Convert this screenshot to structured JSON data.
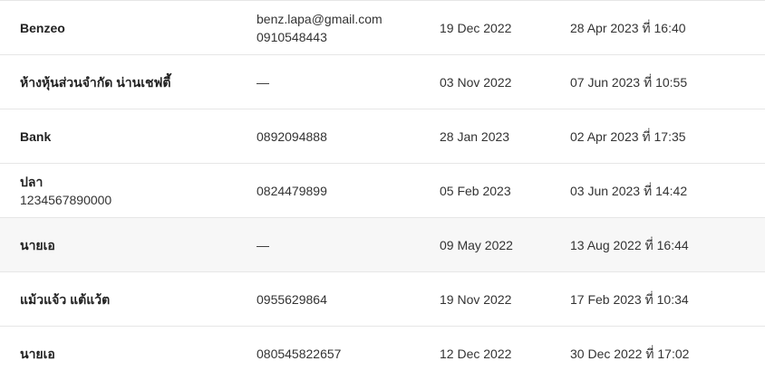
{
  "rows": [
    {
      "name": "Benzeo",
      "name_sub": "",
      "contact_1": "benz.lapa@gmail.com",
      "contact_2": "0910548443",
      "created": "19 Dec 2022",
      "last": "28 Apr 2023 ที่ 16:40",
      "highlight": false
    },
    {
      "name": "ห้างหุ้นส่วนจำกัด น่านเชฟตี้",
      "name_sub": "",
      "contact_1": "—",
      "contact_2": "",
      "created": "03 Nov 2022",
      "last": "07 Jun 2023 ที่ 10:55",
      "highlight": false
    },
    {
      "name": "Bank",
      "name_sub": "",
      "contact_1": "0892094888",
      "contact_2": "",
      "created": "28 Jan 2023",
      "last": "02 Apr 2023 ที่ 17:35",
      "highlight": false
    },
    {
      "name": "ปลา",
      "name_sub": "1234567890000",
      "contact_1": "0824479899",
      "contact_2": "",
      "created": "05 Feb 2023",
      "last": "03 Jun 2023 ที่ 14:42",
      "highlight": false
    },
    {
      "name": "นายเอ",
      "name_sub": "",
      "contact_1": "—",
      "contact_2": "",
      "created": "09 May 2022",
      "last": "13 Aug 2022 ที่ 16:44",
      "highlight": true
    },
    {
      "name": "แม้วแจ้ว แต้แว้ต",
      "name_sub": "",
      "contact_1": "0955629864",
      "contact_2": "",
      "created": "19 Nov 2022",
      "last": "17 Feb 2023 ที่ 10:34",
      "highlight": false
    },
    {
      "name": "นายเอ",
      "name_sub": "",
      "contact_1": "080545822657",
      "contact_2": "",
      "created": "12 Dec 2022",
      "last": "30 Dec 2022 ที่ 17:02",
      "highlight": false
    }
  ]
}
